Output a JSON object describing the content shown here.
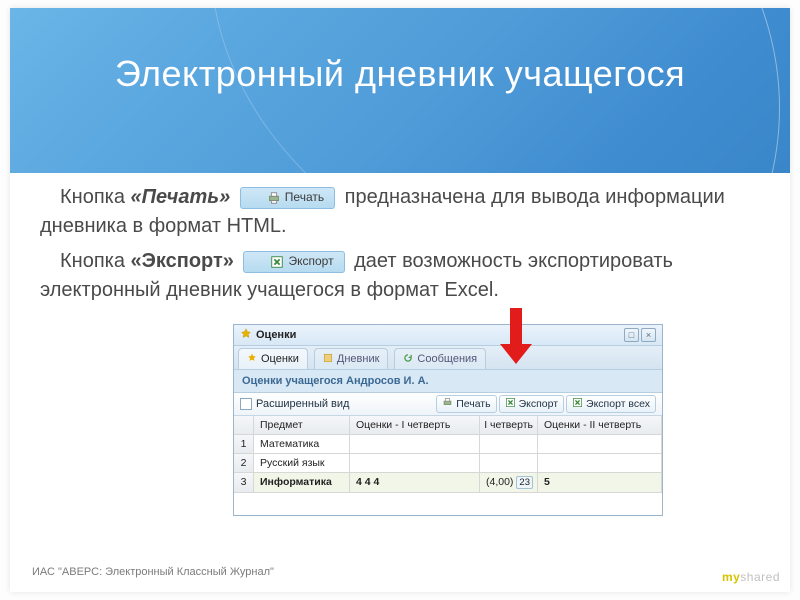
{
  "title": "Электронный дневник учащегося",
  "body": {
    "p1_a": "Кнопка ",
    "p1_b": "«Печать»",
    "p1_c": "  предназначена для вывода информации дневника в формат HTML.",
    "p2_a": "Кнопка ",
    "p2_b": "«Экспорт»",
    "p2_c": " дает возможность экспортировать электронный дневник учащегося в формат Excel."
  },
  "inline_buttons": {
    "print": "Печать",
    "export": "Экспорт"
  },
  "window": {
    "title": "Оценки",
    "tabs": [
      "Оценки",
      "Дневник",
      "Сообщения"
    ],
    "subhead": "Оценки учащегося Андросов И. А.",
    "expanded_label": "Расширенный вид",
    "tool_buttons": [
      "Печать",
      "Экспорт",
      "Экспорт всех"
    ],
    "columns": [
      "Предмет",
      "Оценки - I четверть",
      "I четверть",
      "Оценки - II четверть"
    ],
    "row_labels": [
      "1",
      "2",
      "3"
    ],
    "rows": [
      {
        "subject": "Математика",
        "gradesQ1": "",
        "avgQ1": "",
        "gradesQ2": ""
      },
      {
        "subject": "Русский язык",
        "gradesQ1": "",
        "avgQ1": "",
        "gradesQ2": ""
      },
      {
        "subject": "Информатика",
        "gradesQ1": "4 4 4",
        "avgQ1": "(4,00)",
        "avgBadge": "23",
        "gradesQ2": "5"
      }
    ]
  },
  "footnote": "ИАС \"АВЕРС: Электронный Классный Журнал\"",
  "watermark_a": "my",
  "watermark_b": "shared"
}
